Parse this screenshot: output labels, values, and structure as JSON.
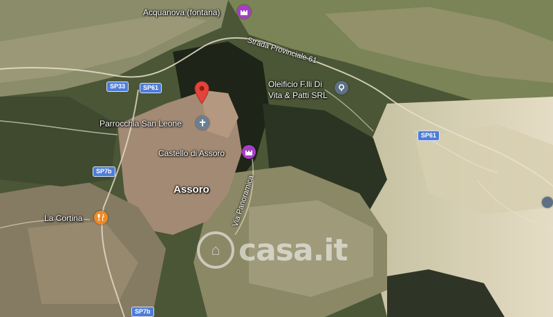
{
  "places": {
    "acquanova": "Acquanova (fontana)",
    "strada": "Strada Provinciale 61",
    "oleificio_line1": "Oleificio F.lli Di",
    "oleificio_line2": "Vita & Patti SRL",
    "parrocchia": "Parrocchia San Leone",
    "castello": "Castello di Assoro",
    "assoro": "Assoro",
    "la_cortina": "La Cortina",
    "via_panoramica": "Via Panoramica"
  },
  "roads": {
    "sp33": "SP33",
    "sp61_a": "SP61",
    "sp61_b": "SP61",
    "sp7b_a": "SP7b",
    "sp7b_b": "SP7b"
  },
  "watermark": "casa.it",
  "colors": {
    "pin": "#e5433a",
    "attraction": "#a63fc6",
    "restaurant": "#f08a24",
    "church": "#6b7f94",
    "business": "#5c7185",
    "road_shield": "#4f7dd6"
  },
  "icons": {
    "pin": "map-pin-icon",
    "attraction": "castle-icon",
    "restaurant": "fork-knife-icon",
    "church": "cross-icon",
    "business": "location-icon"
  }
}
